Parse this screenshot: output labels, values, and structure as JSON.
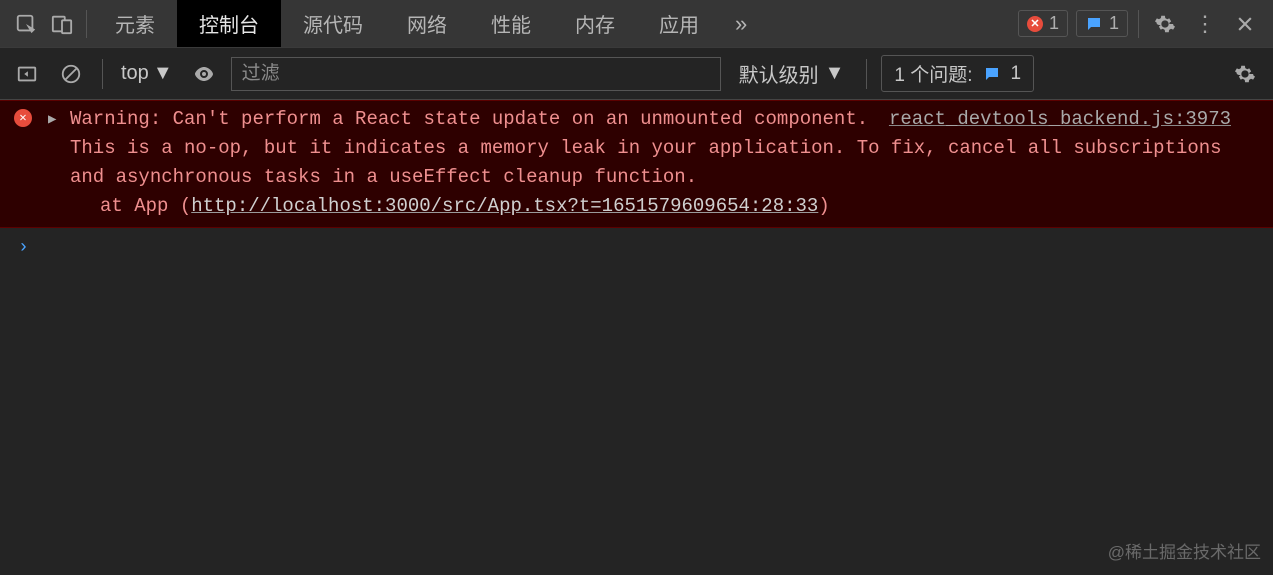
{
  "tabs": {
    "items": [
      {
        "label": "元素"
      },
      {
        "label": "控制台"
      },
      {
        "label": "源代码"
      },
      {
        "label": "网络"
      },
      {
        "label": "性能"
      },
      {
        "label": "内存"
      },
      {
        "label": "应用"
      }
    ],
    "active_index": 1
  },
  "tab_badges": {
    "error_count": "1",
    "issue_count": "1"
  },
  "toolbar": {
    "context": "top",
    "filter_placeholder": "过滤",
    "level_label": "默认级别",
    "issues_label": "1 个问题:",
    "issues_count": "1"
  },
  "console": {
    "error": {
      "prefix": "Warning: ",
      "message": "Can't perform a React state update on an unmounted component. This is a no-op, but it indicates a memory leak in your application. To fix, cancel all subscriptions and asynchronous tasks in a useEffect cleanup function.",
      "source_link": "react_devtools_backend.js:3973",
      "stack_prefix": "at App (",
      "stack_link": "http://localhost:3000/src/App.tsx?t=1651579609654:28:33",
      "stack_suffix": ")"
    },
    "prompt": "›"
  },
  "watermark": "@稀土掘金技术社区"
}
